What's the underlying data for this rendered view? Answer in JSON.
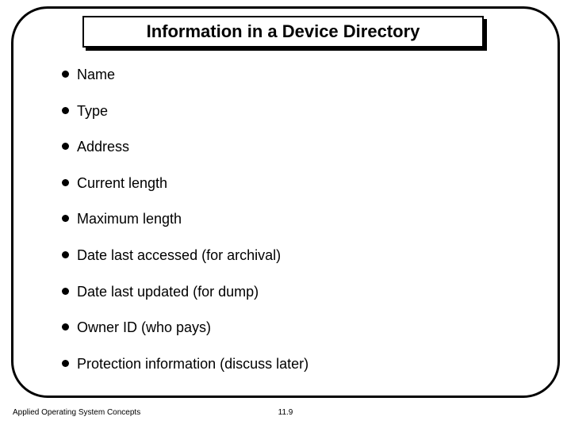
{
  "title": "Information in a Device Directory",
  "bullets": [
    "Name",
    "Type",
    "Address",
    "Current length",
    "Maximum length",
    "Date last accessed (for archival)",
    "Date last updated (for dump)",
    "Owner ID (who pays)",
    "Protection information (discuss later)"
  ],
  "footer": {
    "left": "Applied Operating System Concepts",
    "center": "11.9"
  }
}
